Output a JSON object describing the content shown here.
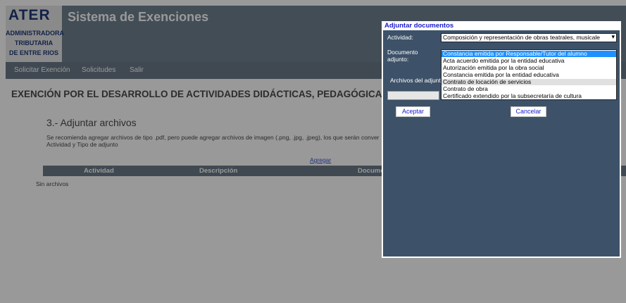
{
  "logo": {
    "brand": "ATER",
    "line1": "ADMINISTRADORA",
    "line2": "TRIBUTARIA",
    "line3": "DE ENTRE RIOS"
  },
  "header": {
    "title": "Sistema de Exenciones"
  },
  "nav": {
    "items": [
      "Solicitar Exención",
      "Solicitudes",
      "Salir"
    ]
  },
  "main": {
    "heading": "EXENCIÓN POR EL DESARROLLO DE ACTIVIDADES DIDÁCTICAS, PEDAGÓGICAS, CU",
    "step_title": "3.- Adjuntar archivos",
    "recommend_text": "Se recomienda agregar archivos de tipo .pdf, pero puede agregar archivos de imagen (.png, .jpg, .jpeg), los que serán conver",
    "recommend_text2": "Actividad y Tipo de adjunto",
    "add_link": "Agregar",
    "table_headers": [
      "Actividad",
      "Descripción",
      "Documen"
    ],
    "empty_text": "Sin archivos"
  },
  "dialog": {
    "title": "Adjuntar documentos",
    "actividad_label": "Actividad:",
    "actividad_value": "Composición y representación de obras teatrales, musicale",
    "documento_label_line1": "Documento",
    "documento_label_line2": "adjunto:",
    "documento_options": [
      "Constancia emitida por Responsable/Tutor del alumno",
      "Acta acuerdo emitida por la entidad educativa",
      "Autorización emitida por la obra social",
      "Constancia emitida por la entidad educativa",
      "Contrato de locación de servicios",
      "Contrato de obra",
      "Certificado extendido por la subsecretaría de cultura"
    ],
    "selected_option_index": 0,
    "hover_option_index": 4,
    "archivos_label": "Archivos del adjunt",
    "accept_label": "Aceptar",
    "cancel_label": "Cancelar"
  },
  "colors": {
    "header_bg": "#708090",
    "dialog_bg": "#3d5268",
    "selected_bg": "#1e90ff",
    "dialog_title": "#1a1acc"
  }
}
